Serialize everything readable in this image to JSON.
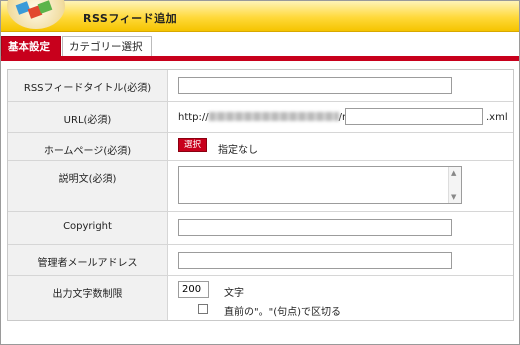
{
  "header": {
    "title": "RSSフィード追加"
  },
  "tabs": [
    {
      "label": "基本設定",
      "active": true
    },
    {
      "label": "カテゴリー選択",
      "active": false
    }
  ],
  "form": {
    "rows": [
      {
        "label": "RSSフィードタイトル(必須)",
        "value": ""
      },
      {
        "label": "URL(必須)",
        "prefix": "http://",
        "middle": "/rss/",
        "value": "",
        "suffix": ".xml"
      },
      {
        "label": "ホームページ(必須)",
        "button": "選択",
        "value_text": "指定なし"
      },
      {
        "label": "説明文(必須)",
        "value": ""
      },
      {
        "label": "Copyright",
        "value": ""
      },
      {
        "label": "管理者メールアドレス",
        "value": ""
      },
      {
        "label": "出力文字数制限",
        "value": "200",
        "unit": "文字",
        "checkbox_label": "直前の\"。\"(句点)で区切る",
        "checked": false
      }
    ]
  },
  "colors": {
    "accent": "#c8001c",
    "header_yellow": "#ffd93a",
    "label_bg": "#f1f1f1"
  }
}
